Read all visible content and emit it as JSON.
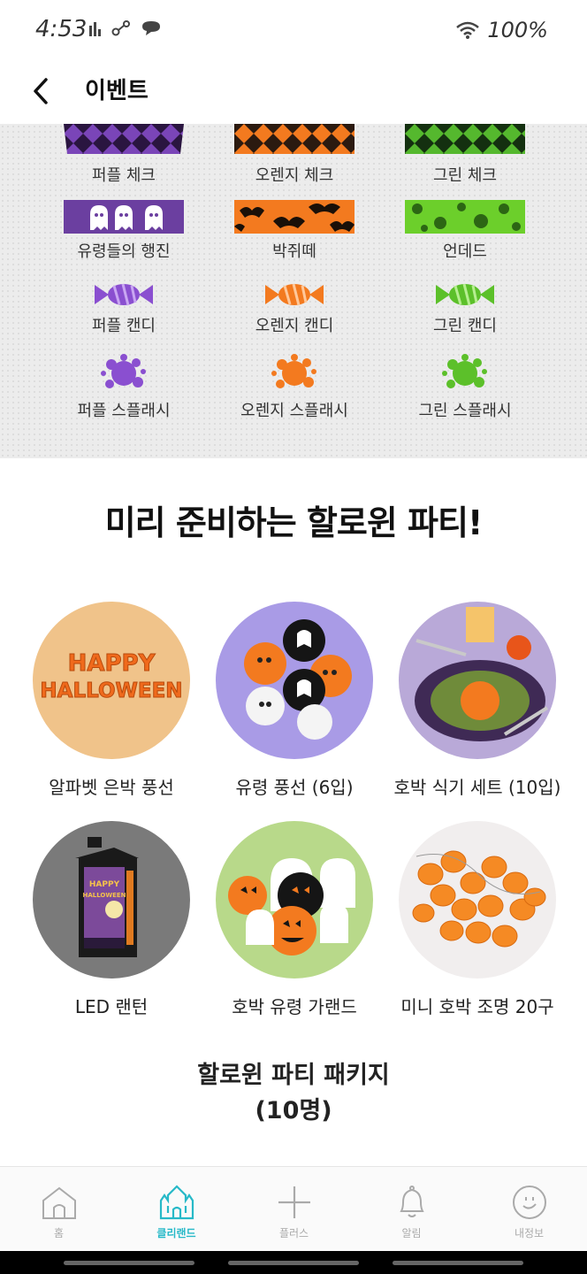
{
  "status_bar": {
    "time": "4:53",
    "battery": "100%"
  },
  "header": {
    "title": "이벤트"
  },
  "patterns": [
    {
      "label": "퍼플 체크",
      "color": "#6b3fa0"
    },
    {
      "label": "오렌지 체크",
      "color": "#f37a1f"
    },
    {
      "label": "그린 체크",
      "color": "#55b82e"
    },
    {
      "label": "유령들의 행진",
      "color": "#6b3fa0"
    },
    {
      "label": "박쥐떼",
      "color": "#f37a1f"
    },
    {
      "label": "언데드",
      "color": "#6ccf2b"
    },
    {
      "label": "퍼플 캔디",
      "color": "#8a4fd0"
    },
    {
      "label": "오렌지 캔디",
      "color": "#f37a1f"
    },
    {
      "label": "그린 캔디",
      "color": "#6ccf2b"
    },
    {
      "label": "퍼플 스플래시",
      "color": "#8a4fd0"
    },
    {
      "label": "오렌지 스플래시",
      "color": "#f37a1f"
    },
    {
      "label": "그린 스플래시",
      "color": "#6ccf2b"
    }
  ],
  "headline": "미리 준비하는 할로윈 파티!",
  "products": [
    {
      "name": "알파벳 은박 풍선",
      "image_text": [
        "HAPPY",
        "HALLOWEEN"
      ]
    },
    {
      "name": "유령 풍선 (6입)"
    },
    {
      "name": "호박 식기 세트 (10입)"
    },
    {
      "name": "LED 랜턴",
      "image_text": [
        "HAPPY",
        "HALLOWEEN"
      ]
    },
    {
      "name": "호박 유령 가랜드"
    },
    {
      "name": "미니 호박 조명 20구"
    }
  ],
  "package": {
    "line1": "할로윈 파티 패키지",
    "line2": "(10명)"
  },
  "bottom_nav": [
    {
      "label": "홈",
      "icon": "home-icon"
    },
    {
      "label": "클리랜드",
      "icon": "castle-icon",
      "active": true
    },
    {
      "label": "플러스",
      "icon": "plus-icon"
    },
    {
      "label": "알림",
      "icon": "bell-icon"
    },
    {
      "label": "내정보",
      "icon": "smile-icon"
    }
  ],
  "colors": {
    "accent": "#27b9c8",
    "purple": "#6b3fa0",
    "orange": "#f37a1f",
    "green": "#55b82e"
  }
}
